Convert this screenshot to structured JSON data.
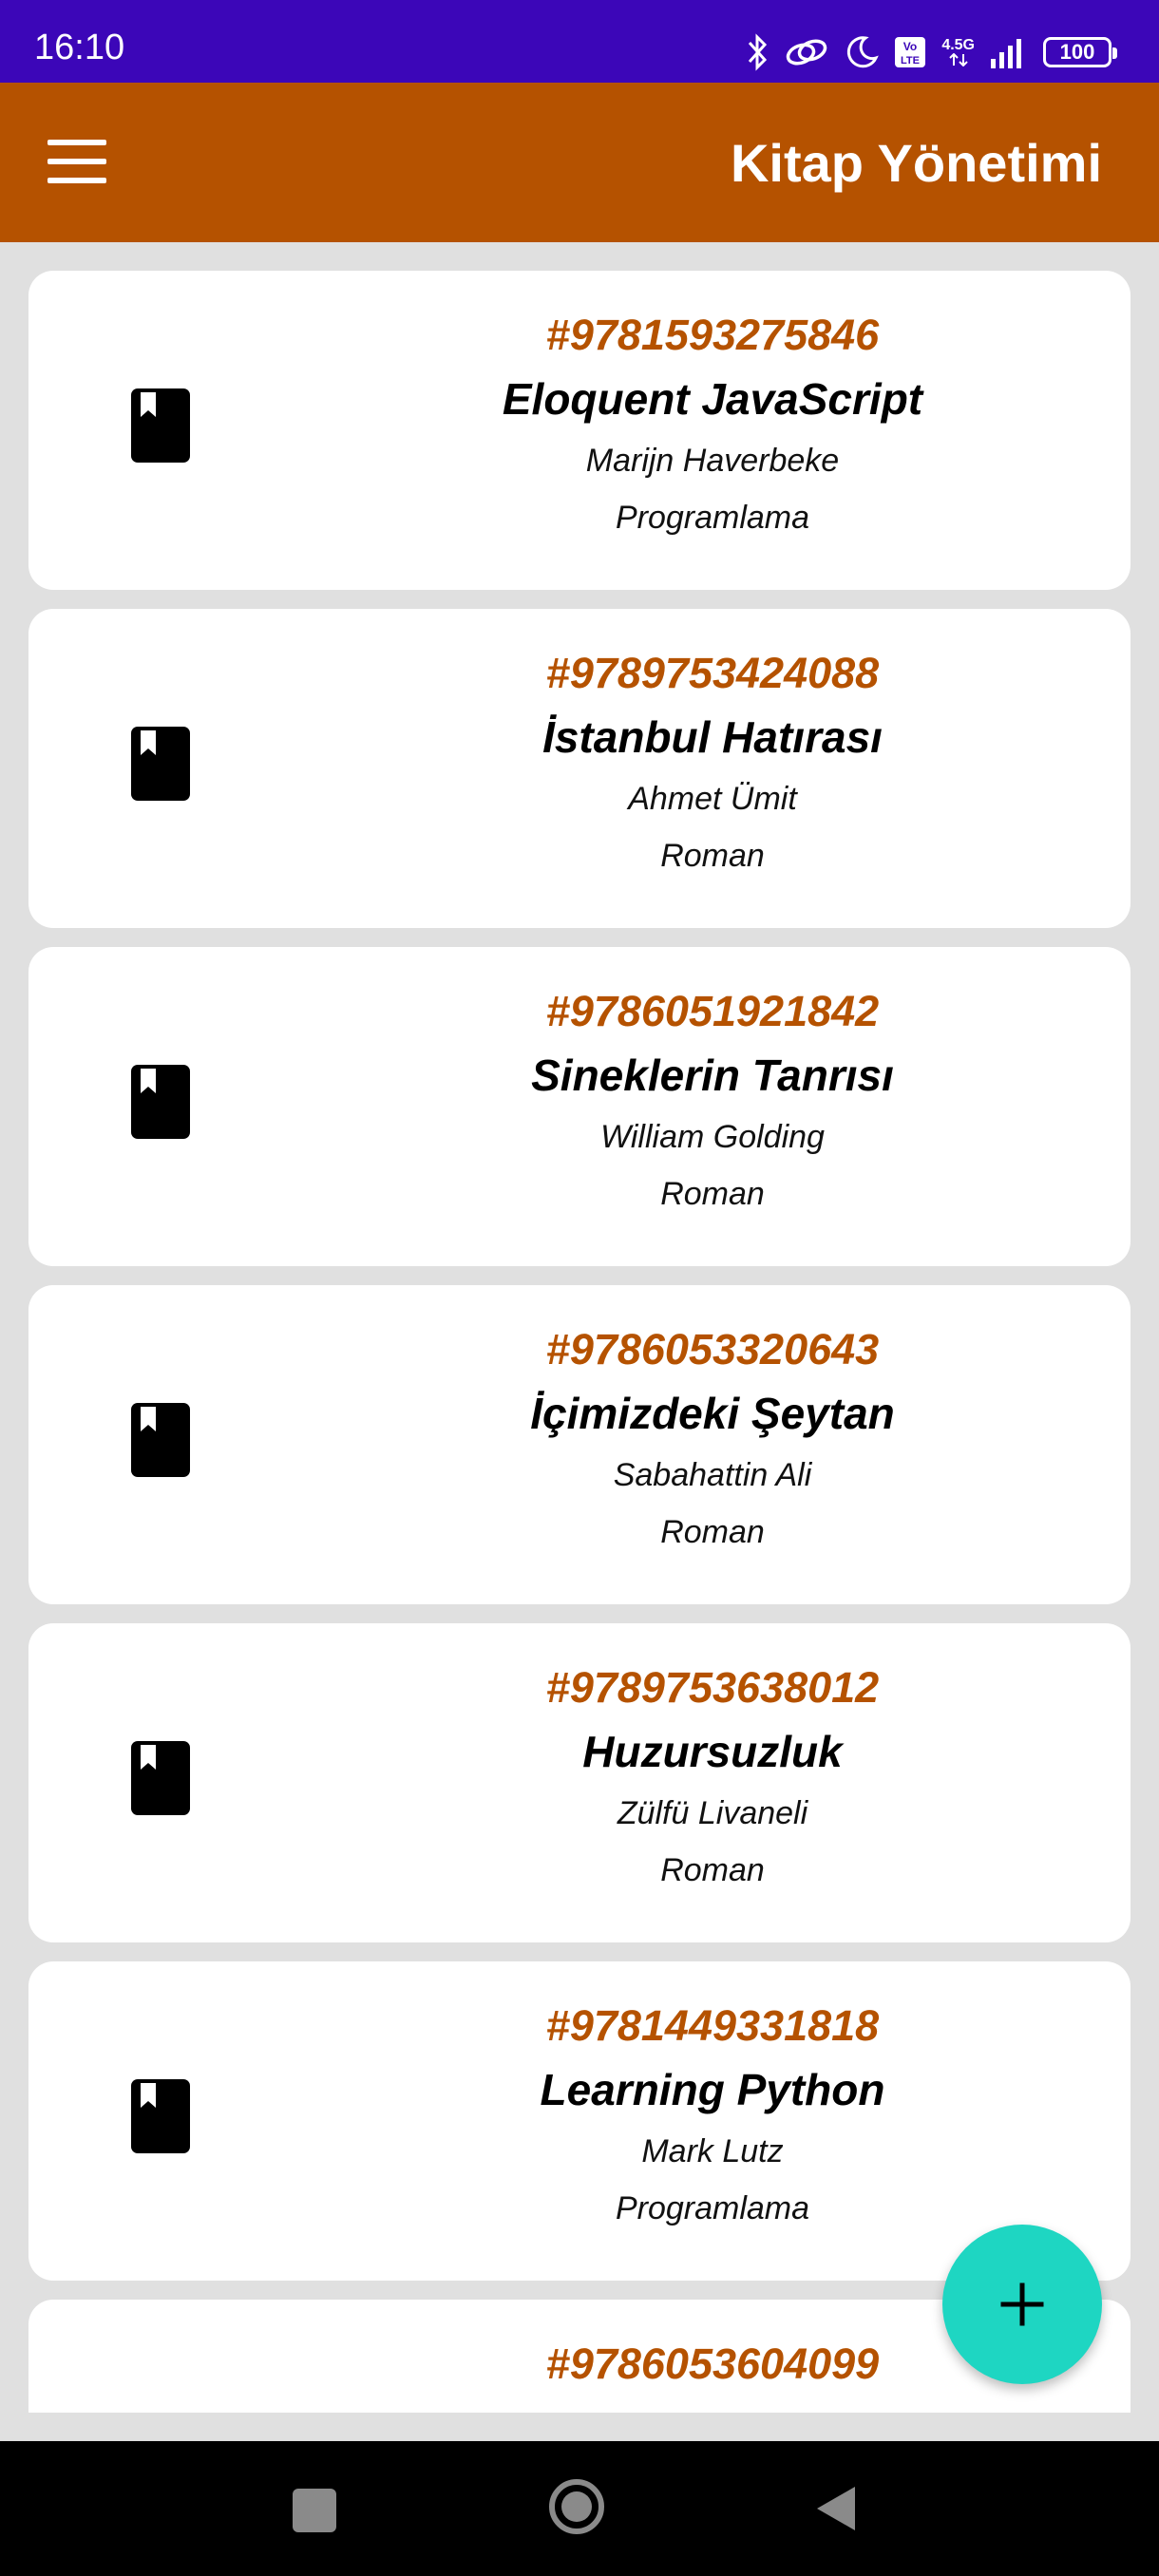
{
  "status_bar": {
    "time": "16:10",
    "network_top": "4.5G",
    "network_volte": "Vo LTE",
    "battery": "100",
    "icons": [
      "bluetooth-icon",
      "link-icon",
      "moon-icon",
      "volte-icon",
      "signal-icon",
      "battery-icon"
    ]
  },
  "app_bar": {
    "title": "Kitap Yönetimi",
    "menu_icon": "hamburger-menu-icon",
    "background": "#b55200"
  },
  "books": [
    {
      "isbn": "#9781593275846",
      "title": "Eloquent JavaScript",
      "author": "Marijn Haverbeke",
      "category": "Programlama"
    },
    {
      "isbn": "#9789753424088",
      "title": "İstanbul Hatırası",
      "author": "Ahmet Ümit",
      "category": "Roman"
    },
    {
      "isbn": "#9786051921842",
      "title": "Sineklerin Tanrısı",
      "author": "William Golding",
      "category": "Roman"
    },
    {
      "isbn": "#9786053320643",
      "title": "İçimizdeki Şeytan",
      "author": "Sabahattin Ali",
      "category": "Roman"
    },
    {
      "isbn": "#9789753638012",
      "title": "Huzursuzluk",
      "author": "Zülfü Livaneli",
      "category": "Roman"
    },
    {
      "isbn": "#9781449331818",
      "title": "Learning Python",
      "author": "Mark Lutz",
      "category": "Programlama"
    },
    {
      "isbn": "#9786053604099",
      "title": "",
      "author": "",
      "category": ""
    }
  ],
  "fab": {
    "icon": "plus-icon",
    "color": "#1ed6c2"
  },
  "nav_bar": {
    "icons": [
      "recents-icon",
      "home-icon",
      "back-icon"
    ]
  },
  "colors": {
    "status_bar": "#3c06b8",
    "accent": "#b55200",
    "list_background": "#e0e0e0"
  }
}
